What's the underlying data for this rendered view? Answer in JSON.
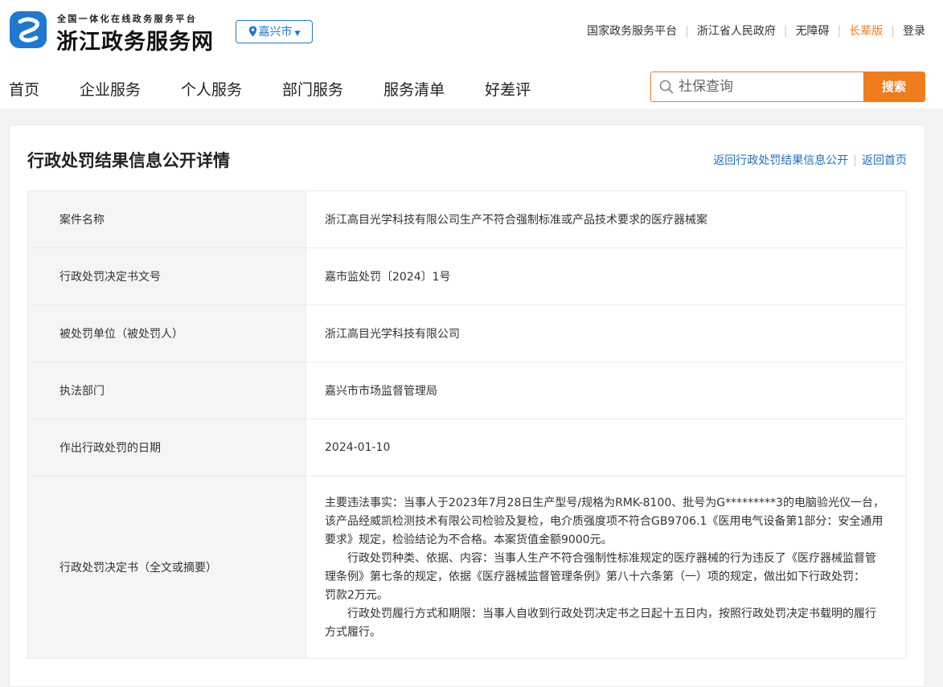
{
  "header": {
    "logo_subtitle": "全国一体化在线政务服务平台",
    "logo_title": "浙江政务服务网",
    "city": "嘉兴市",
    "top_links": [
      "国家政务服务平台",
      "浙江省人民政府",
      "无障碍",
      "长辈版",
      "登录"
    ]
  },
  "nav": {
    "items": [
      "首页",
      "企业服务",
      "个人服务",
      "部门服务",
      "服务清单",
      "好差评"
    ]
  },
  "search": {
    "placeholder": "社保查询",
    "button": "搜索"
  },
  "detail": {
    "title": "行政处罚结果信息公开详情",
    "link_back_list": "返回行政处罚结果信息公开",
    "link_back_home": "返回首页",
    "rows": [
      {
        "label": "案件名称",
        "value": "浙江高目光学科技有限公司生产不符合强制标准或产品技术要求的医疗器械案"
      },
      {
        "label": "行政处罚决定书文号",
        "value": "嘉市监处罚〔2024〕1号"
      },
      {
        "label": "被处罚单位（被处罚人）",
        "value": "浙江高目光学科技有限公司"
      },
      {
        "label": "执法部门",
        "value": "嘉兴市市场监督管理局"
      },
      {
        "label": "作出行政处罚的日期",
        "value": "2024-01-10"
      }
    ],
    "decision": {
      "label": "行政处罚决定书（全文或摘要）",
      "paragraphs": [
        "主要违法事实：当事人于2023年7月28日生产型号/规格为RMK-8100、批号为G*********3的电脑验光仪一台，该产品经威凯检测技术有限公司检验及复检，电介质强度项不符合GB9706.1《医用电气设备第1部分：安全通用要求》规定，检验结论为不合格。本案货值金额9000元。",
        "行政处罚种类、依据、内容：当事人生产不符合强制性标准规定的医疗器械的行为违反了《医疗器械监督管理条例》第七条的规定，依据《医疗器械监督管理条例》第八十六条第（一）项的规定，做出如下行政处罚：",
        "罚款2万元。",
        "行政处罚履行方式和期限：当事人自收到行政处罚决定书之日起十五日内，按照行政处罚决定书载明的履行方式履行。"
      ]
    }
  }
}
